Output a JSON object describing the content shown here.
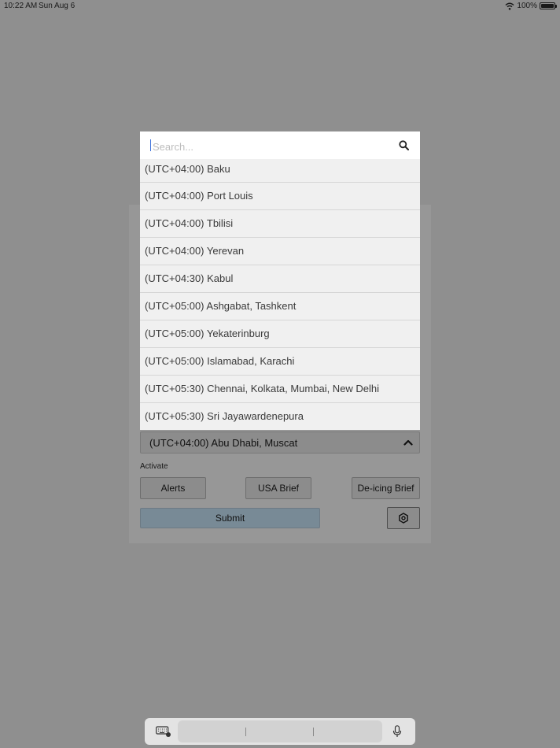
{
  "status_bar": {
    "time": "10:22 AM",
    "date": "Sun Aug 6",
    "battery": "100%"
  },
  "search": {
    "placeholder": "Search...",
    "value": ""
  },
  "timezones": [
    "(UTC+04:00) Baku",
    "(UTC+04:00) Port Louis",
    "(UTC+04:00) Tbilisi",
    "(UTC+04:00) Yerevan",
    "(UTC+04:30) Kabul",
    "(UTC+05:00) Ashgabat, Tashkent",
    "(UTC+05:00) Yekaterinburg",
    "(UTC+05:00) Islamabad, Karachi",
    "(UTC+05:30) Chennai, Kolkata, Mumbai, New Delhi",
    "(UTC+05:30) Sri Jayawardenepura"
  ],
  "form": {
    "selected_timezone": "(UTC+04:00) Abu Dhabi, Muscat",
    "activate_label": "Activate",
    "buttons": {
      "alerts": "Alerts",
      "usa_brief": "USA Brief",
      "deicing_brief": "De-icing Brief"
    },
    "submit": "Submit"
  },
  "icons": {
    "search": "search-icon",
    "settings": "hexagon-gear-icon",
    "chevron": "chevron-up-icon",
    "keyboard": "keyboard-icon",
    "mic": "microphone-icon"
  }
}
